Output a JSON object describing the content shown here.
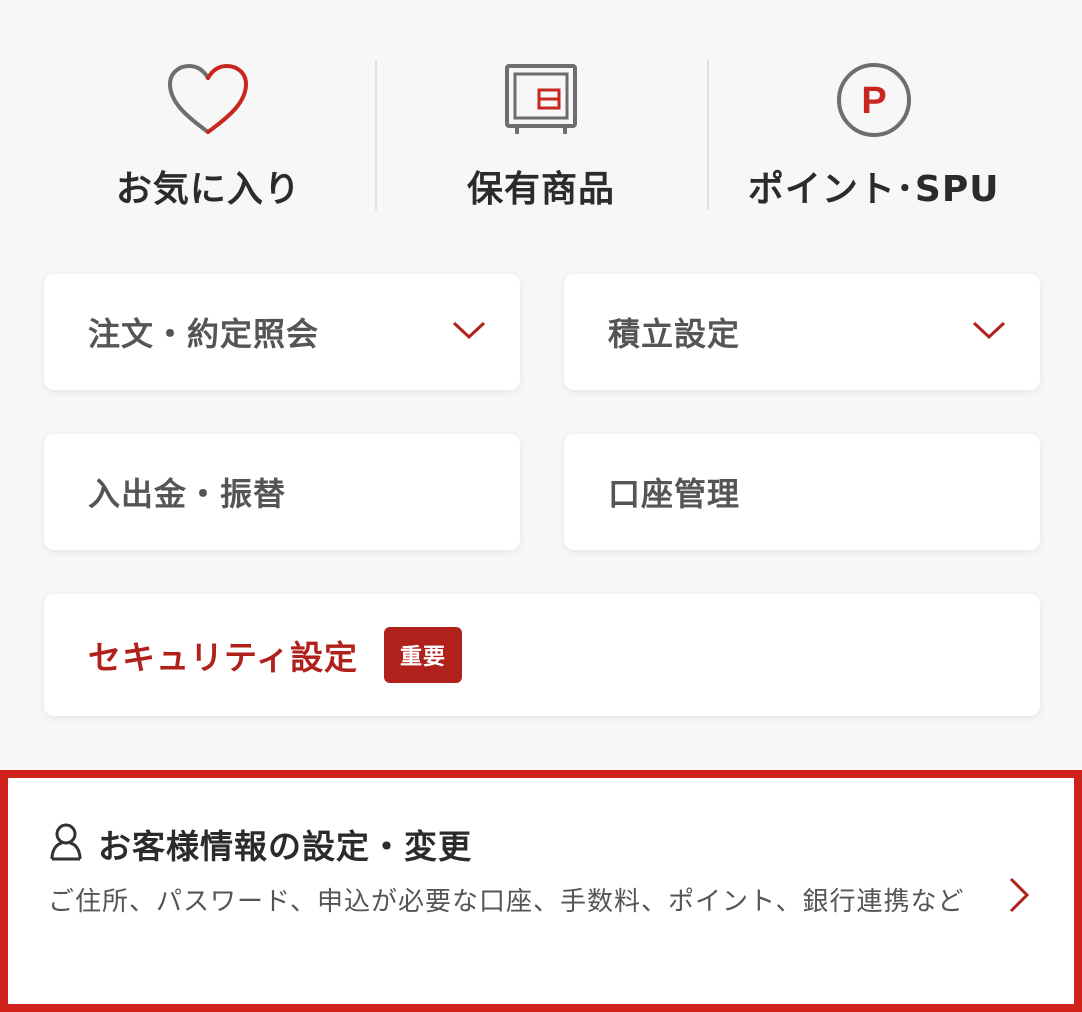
{
  "top_nav": [
    {
      "label": "お気に入り",
      "icon": "heart-icon"
    },
    {
      "label": "保有商品",
      "icon": "holdings-icon"
    },
    {
      "label": "ポイント･SPU",
      "icon": "point-icon",
      "icon_text": "P"
    }
  ],
  "menu": {
    "orders": {
      "label": "注文・約定照会"
    },
    "accumulation": {
      "label": "積立設定"
    },
    "deposit": {
      "label": "入出金・振替"
    },
    "account_mgmt": {
      "label": "口座管理"
    },
    "security": {
      "label": "セキュリティ設定",
      "badge": "重要"
    }
  },
  "customer_info": {
    "title": "お客様情報の設定・変更",
    "description": "ご住所、パスワード、申込が必要な口座、手数料、ポイント、銀行連携など"
  },
  "colors": {
    "accent": "#b0211b",
    "highlight_border": "#d0211b",
    "icon_gray": "#6e6e6e"
  }
}
